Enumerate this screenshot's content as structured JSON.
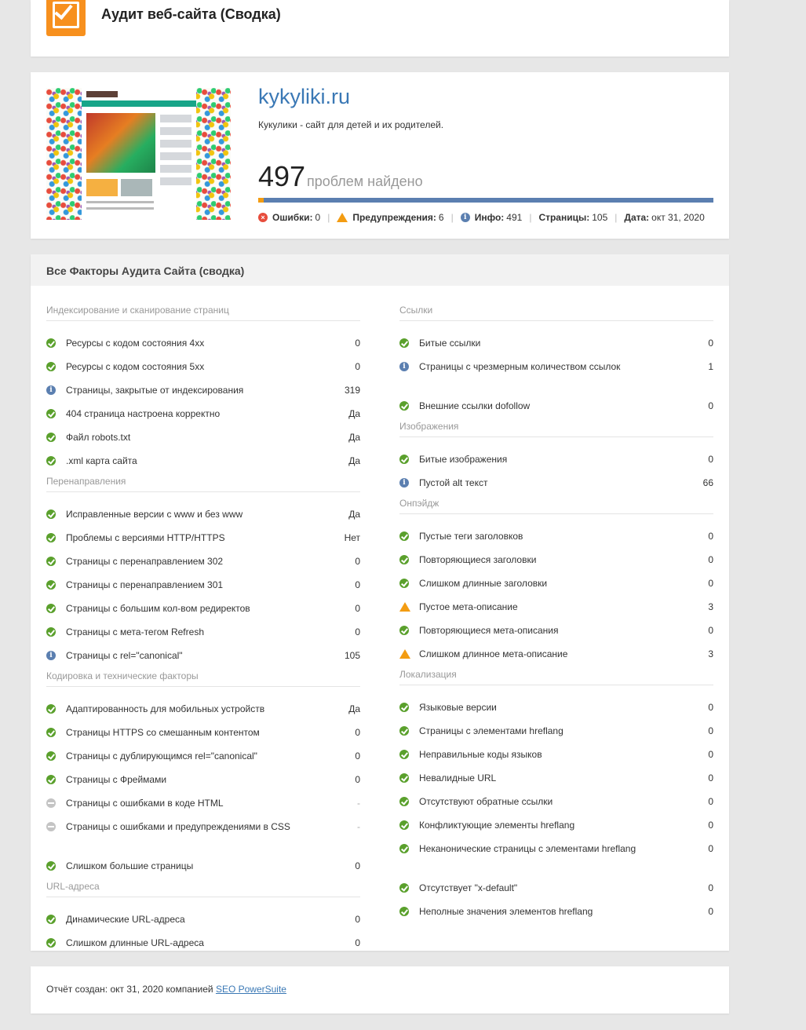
{
  "header": {
    "title": "Аудит веб-сайта (Сводка)",
    "logo_icon": "checkbox-icon",
    "accent": "#f7901e"
  },
  "summary": {
    "site": "kykyliki.ru",
    "description": "Кукулики - сайт для детей и их родителей.",
    "issues_count": "497",
    "issues_label": "проблем найдено",
    "stats": {
      "errors_label": "Ошибки:",
      "errors_value": "0",
      "warnings_label": "Предупреждения:",
      "warnings_value": "6",
      "info_label": "Инфо:",
      "info_value": "491",
      "pages_label": "Страницы:",
      "pages_value": "105",
      "date_label": "Дата:",
      "date_value": "окт 31, 2020"
    }
  },
  "factors": {
    "title": "Все Факторы Аудита Сайта (сводка)",
    "left": {
      "s1": {
        "title": "Индексирование и сканирование страниц",
        "items": [
          {
            "label": "Ресурсы с кодом состояния 4xx",
            "value": "0",
            "status": "ok"
          },
          {
            "label": "Ресурсы с кодом состояния 5xx",
            "value": "0",
            "status": "ok"
          },
          {
            "label": "Страницы, закрытые от индексирования",
            "value": "319",
            "status": "info"
          },
          {
            "label": "404 страница настроена корректно",
            "value": "Да",
            "status": "ok"
          },
          {
            "label": "Файл robots.txt",
            "value": "Да",
            "status": "ok"
          },
          {
            "label": ".xml карта сайта",
            "value": "Да",
            "status": "ok"
          }
        ]
      },
      "s2": {
        "title": "Перенаправления",
        "items": [
          {
            "label": "Исправленные версии с www и без www",
            "value": "Да",
            "status": "ok"
          },
          {
            "label": "Проблемы с версиями HTTP/HTTPS",
            "value": "Нет",
            "status": "ok"
          },
          {
            "label": "Страницы с перенаправлением 302",
            "value": "0",
            "status": "ok"
          },
          {
            "label": "Страницы с перенаправлением 301",
            "value": "0",
            "status": "ok"
          },
          {
            "label": "Страницы с большим кол-вом редиректов",
            "value": "0",
            "status": "ok"
          },
          {
            "label": "Страницы с мета-тегом Refresh",
            "value": "0",
            "status": "ok"
          },
          {
            "label": "Страницы с rel=\"canonical\"",
            "value": "105",
            "status": "info"
          }
        ]
      },
      "s3": {
        "title": "Кодировка и технические факторы",
        "items": [
          {
            "label": "Адаптированность для мобильных устройств",
            "value": "Да",
            "status": "ok"
          },
          {
            "label": "Страницы HTTPS со смешанным контентом",
            "value": "0",
            "status": "ok"
          },
          {
            "label": "Страницы с дублирующимся rel=\"canonical\"",
            "value": "0",
            "status": "ok"
          },
          {
            "label": "Страницы с Фреймами",
            "value": "0",
            "status": "ok"
          },
          {
            "label": "Страницы с ошибками в коде HTML",
            "value": "-",
            "status": "na"
          },
          {
            "label": "Страницы с ошибками и предупреждениями в CSS",
            "value": "-",
            "status": "na"
          },
          {
            "label": "Слишком большие страницы",
            "value": "0",
            "status": "ok"
          }
        ]
      },
      "s4": {
        "title": "URL-адреса",
        "items": [
          {
            "label": "Динамические URL-адреса",
            "value": "0",
            "status": "ok"
          },
          {
            "label": "Слишком длинные URL-адреса",
            "value": "0",
            "status": "ok"
          }
        ]
      }
    },
    "right": {
      "s1": {
        "title": "Ссылки",
        "items": [
          {
            "label": "Битые ссылки",
            "value": "0",
            "status": "ok"
          },
          {
            "label": "Страницы с чрезмерным количеством ссылок",
            "value": "1",
            "status": "info"
          },
          {
            "label": "Внешние ссылки dofollow",
            "value": "0",
            "status": "ok"
          }
        ]
      },
      "s2": {
        "title": "Изображения",
        "items": [
          {
            "label": "Битые изображения",
            "value": "0",
            "status": "ok"
          },
          {
            "label": "Пустой alt текст",
            "value": "66",
            "status": "info"
          }
        ]
      },
      "s3": {
        "title": "Онпэйдж",
        "items": [
          {
            "label": "Пустые теги заголовков",
            "value": "0",
            "status": "ok"
          },
          {
            "label": "Повторяющиеся заголовки",
            "value": "0",
            "status": "ok"
          },
          {
            "label": "Слишком длинные заголовки",
            "value": "0",
            "status": "ok"
          },
          {
            "label": "Пустое мета-описание",
            "value": "3",
            "status": "warn"
          },
          {
            "label": "Повторяющиеся мета-описания",
            "value": "0",
            "status": "ok"
          },
          {
            "label": "Слишком длинное мета-описание",
            "value": "3",
            "status": "warn"
          }
        ]
      },
      "s4": {
        "title": "Локализация",
        "items": [
          {
            "label": "Языковые версии",
            "value": "0",
            "status": "ok"
          },
          {
            "label": "Страницы с элементами hreflang",
            "value": "0",
            "status": "ok"
          },
          {
            "label": "Неправильные коды языков",
            "value": "0",
            "status": "ok"
          },
          {
            "label": "Невалидные URL",
            "value": "0",
            "status": "ok"
          },
          {
            "label": "Отсутствуют обратные ссылки",
            "value": "0",
            "status": "ok"
          },
          {
            "label": "Конфликтующие элементы hreflang",
            "value": "0",
            "status": "ok"
          },
          {
            "label": "Неканонические страницы с элементами hreflang",
            "value": "0",
            "status": "ok"
          },
          {
            "label": "Отсутствует \"x-default\"",
            "value": "0",
            "status": "ok"
          },
          {
            "label": "Неполные значения элементов hreflang",
            "value": "0",
            "status": "ok"
          }
        ]
      }
    }
  },
  "footer": {
    "text": "Отчёт создан: окт 31, 2020 компанией",
    "link": "SEO PowerSuite"
  },
  "colors": {
    "ok": "#5aa02c",
    "info": "#5b7fb0",
    "warn": "#f39c12",
    "error": "#e74c3c",
    "link": "#3a78b5"
  }
}
